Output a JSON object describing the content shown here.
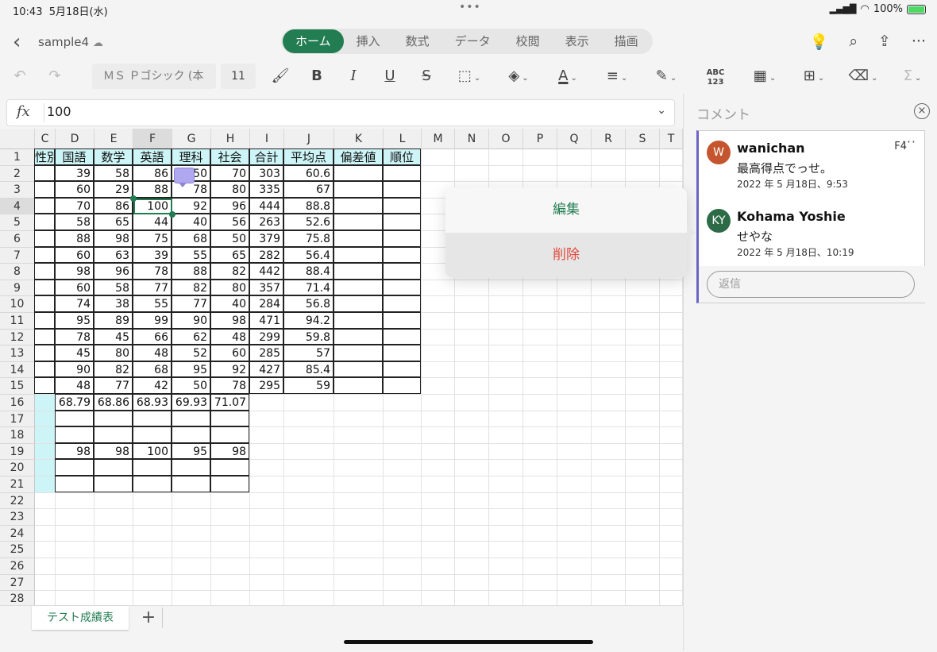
{
  "status": {
    "time": "10:43",
    "date": "5月18日(水)",
    "battery": "100%"
  },
  "title": {
    "filename": "sample4"
  },
  "tabs": [
    "ホーム",
    "挿入",
    "数式",
    "データ",
    "校閲",
    "表示",
    "描画"
  ],
  "toolbar": {
    "font_name": "ＭＳ Ｐゴシック (本",
    "font_size": "11"
  },
  "formula": {
    "value": "100"
  },
  "columns": [
    "C",
    "D",
    "E",
    "F",
    "G",
    "H",
    "I",
    "J",
    "K",
    "L",
    "M",
    "N",
    "O",
    "P",
    "Q",
    "R",
    "S",
    "T"
  ],
  "row_numbers": [
    "1",
    "2",
    "3",
    "4",
    "5",
    "6",
    "7",
    "8",
    "9",
    "10",
    "11",
    "12",
    "13",
    "14",
    "15",
    "16",
    "17",
    "18",
    "19",
    "20",
    "21",
    "22",
    "23",
    "24",
    "25",
    "26",
    "27",
    "28"
  ],
  "table": {
    "c_header": "性別",
    "headers": [
      "国語",
      "数学",
      "英語",
      "理科",
      "社会",
      "合計",
      "平均点",
      "偏差値",
      "順位"
    ],
    "rows": [
      [
        "39",
        "58",
        "86",
        "50",
        "70",
        "303",
        "60.6"
      ],
      [
        "60",
        "29",
        "88",
        "78",
        "80",
        "335",
        "67"
      ],
      [
        "70",
        "86",
        "100",
        "92",
        "96",
        "444",
        "88.8"
      ],
      [
        "58",
        "65",
        "44",
        "40",
        "56",
        "263",
        "52.6"
      ],
      [
        "88",
        "98",
        "75",
        "68",
        "50",
        "379",
        "75.8"
      ],
      [
        "60",
        "63",
        "39",
        "55",
        "65",
        "282",
        "56.4"
      ],
      [
        "98",
        "96",
        "78",
        "88",
        "82",
        "442",
        "88.4"
      ],
      [
        "60",
        "58",
        "77",
        "82",
        "80",
        "357",
        "71.4"
      ],
      [
        "74",
        "38",
        "55",
        "77",
        "40",
        "284",
        "56.8"
      ],
      [
        "95",
        "89",
        "99",
        "90",
        "98",
        "471",
        "94.2"
      ],
      [
        "78",
        "45",
        "66",
        "62",
        "48",
        "299",
        "59.8"
      ],
      [
        "45",
        "80",
        "48",
        "52",
        "60",
        "285",
        "57"
      ],
      [
        "90",
        "82",
        "68",
        "95",
        "92",
        "427",
        "85.4"
      ],
      [
        "48",
        "77",
        "42",
        "50",
        "78",
        "295",
        "59"
      ]
    ],
    "averages": [
      "68.79",
      "68.86",
      "68.93",
      "69.93",
      "71.07"
    ],
    "maxes": [
      "98",
      "98",
      "100",
      "95",
      "98"
    ]
  },
  "sheet": {
    "tab_name": "テスト成績表",
    "add_label": "+"
  },
  "popup": {
    "edit": "編集",
    "delete": "削除"
  },
  "comments": {
    "title": "コメント",
    "cell_ref": "F4",
    "items": [
      {
        "initials": "W",
        "author": "wanichan",
        "text": "最高得点でっせ。",
        "date": "2022 年 5 月18日、9:53",
        "color": "#c4552e"
      },
      {
        "initials": "KY",
        "author": "Kohama Yoshie",
        "text": "せやな",
        "date": "2022 年 5 月18日、10:19",
        "color": "#2d6b47"
      }
    ],
    "reply_placeholder": "返信"
  },
  "colors": {
    "accent": "#237d52",
    "header_fill": "#cdf4f6",
    "comment_marker": "#b0a8ee",
    "delete": "#e0493c"
  }
}
